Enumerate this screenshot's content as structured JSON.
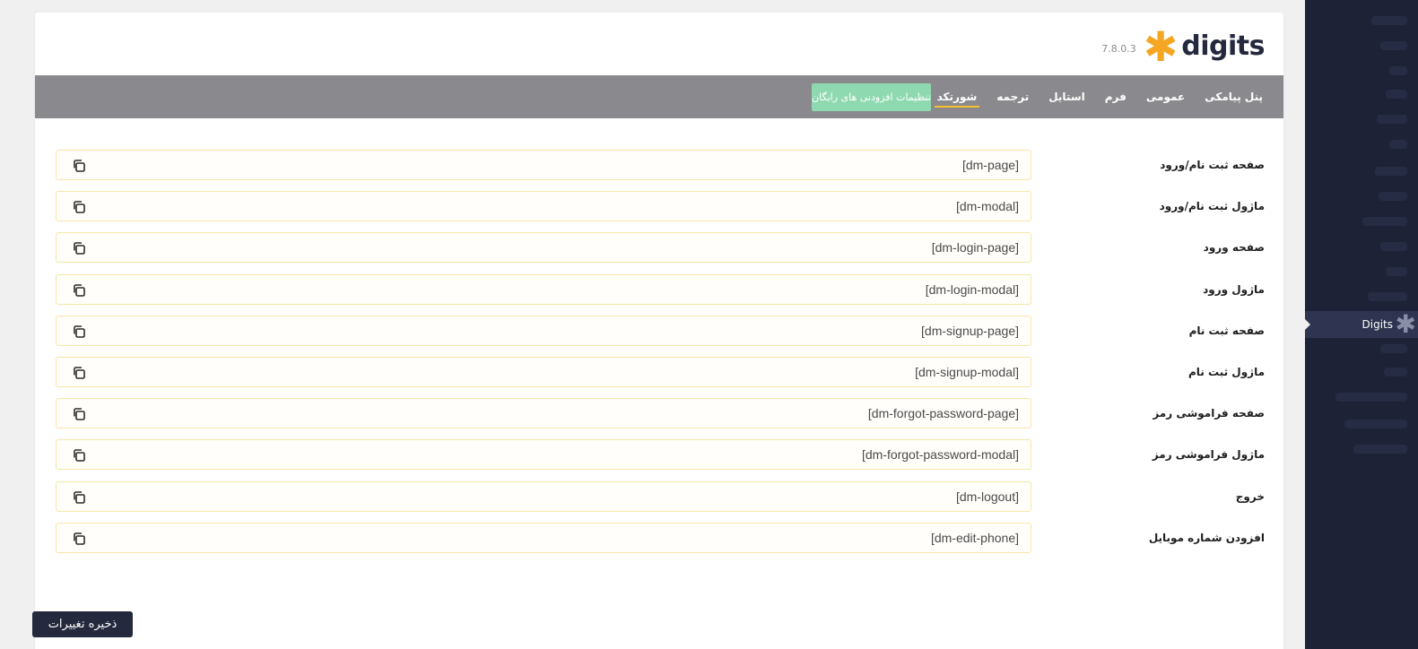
{
  "brand": {
    "version": "7.8.0.3",
    "logo_text": "digits"
  },
  "nav": {
    "tabs": [
      {
        "label": "پنل پیامکی",
        "active": false
      },
      {
        "label": "عمومی",
        "active": false
      },
      {
        "label": "فرم",
        "active": false
      },
      {
        "label": "استایل",
        "active": false
      },
      {
        "label": "ترجمه",
        "active": false
      },
      {
        "label": "شورتکد",
        "active": true
      }
    ],
    "addon_button": "تنظیمات افزودنی های رایگان"
  },
  "shortcodes": [
    {
      "label": "صفحه ثبت نام/ورود",
      "code": "[dm-page]"
    },
    {
      "label": "ماژول ثبت نام/ورود",
      "code": "[dm-modal]"
    },
    {
      "label": "صفحه ورود",
      "code": "[dm-login-page]"
    },
    {
      "label": "ماژول ورود",
      "code": "[dm-login-modal]"
    },
    {
      "label": "صفحه ثبت نام",
      "code": "[dm-signup-page]"
    },
    {
      "label": "ماژول ثبت نام",
      "code": "[dm-signup-modal]"
    },
    {
      "label": "صفحه فراموشی رمز",
      "code": "[dm-forgot-password-page]"
    },
    {
      "label": "ماژول فراموشی رمز",
      "code": "[dm-forgot-password-modal]"
    },
    {
      "label": "خروج",
      "code": "[dm-logout]"
    },
    {
      "label": "افزودن شماره موبایل",
      "code": "[dm-edit-phone]"
    }
  ],
  "save_button": "ذخیره تغییرات",
  "sidebar": {
    "active_item": "Digits"
  },
  "colors": {
    "accent": "#f5c02c",
    "navbar": "#8a898d",
    "addon_button": "#8fd9b0",
    "save_button": "#24293d",
    "sidebar": "#1d2236"
  }
}
